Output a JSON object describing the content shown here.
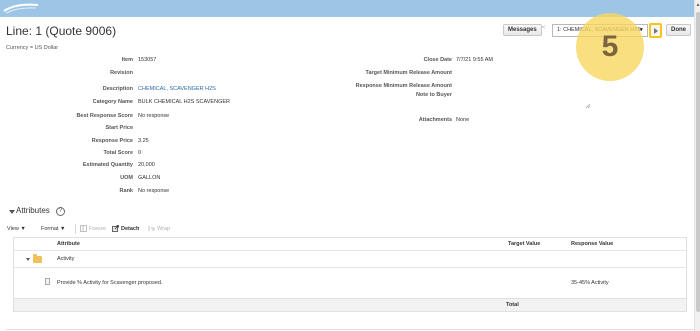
{
  "header": {
    "title": "Line: 1 (Quote 9006)",
    "currency": "Currency = US Dollar",
    "messages_label": "Messages",
    "prev_label": "<",
    "line_select_value": "1: CHEMICAL, SCAVENGER H2S",
    "done_label": "Done"
  },
  "badge": {
    "number": "5"
  },
  "details": {
    "left": [
      {
        "label": "Item",
        "value": "153057"
      },
      {
        "label": "Revision",
        "value": ""
      },
      {
        "label": "Description",
        "value": "CHEMICAL, SCAVENGER H2S"
      },
      {
        "label": "Category Name",
        "value": "BULK CHEMICAL H2S SCAVENGER"
      },
      {
        "label": "Best Response Score",
        "value": "No response"
      },
      {
        "label": "Start Price",
        "value": ""
      },
      {
        "label": "Response Price",
        "value": "3.25"
      },
      {
        "label": "Total Score",
        "value": "0"
      },
      {
        "label": "Estimated Quantity",
        "value": "20,000"
      },
      {
        "label": "UOM",
        "value": "GALLON"
      },
      {
        "label": "Rank",
        "value": "No response"
      }
    ],
    "right": [
      {
        "label": "Close Date",
        "value": "7/7/21 9:55 AM"
      },
      {
        "label": "Target Minimum Release Amount",
        "value": ""
      },
      {
        "label": "Response Minimum Release Amount",
        "value": ""
      },
      {
        "label": "Note to Buyer",
        "value": ""
      },
      {
        "label": "Attachments",
        "value": "None"
      }
    ]
  },
  "attributes": {
    "title": "Attributes",
    "toolbar": {
      "view": "View ▼",
      "format": "Format ▼",
      "freeze": "Freeze",
      "detach": "Detach",
      "wrap": "Wrap"
    },
    "columns": {
      "attribute": "Attribute",
      "target": "Target Value",
      "response": "Response Value"
    },
    "group_row": {
      "name": "Activity"
    },
    "rows": [
      {
        "attribute": "Provide % Activity for Scavenger proposed.",
        "target": "",
        "response": "35-45% Activity"
      }
    ],
    "total_label": "Total"
  },
  "colors": {
    "accent": "#9dc6e6",
    "badge": "#f7d65c",
    "link": "#2c6aa6"
  }
}
